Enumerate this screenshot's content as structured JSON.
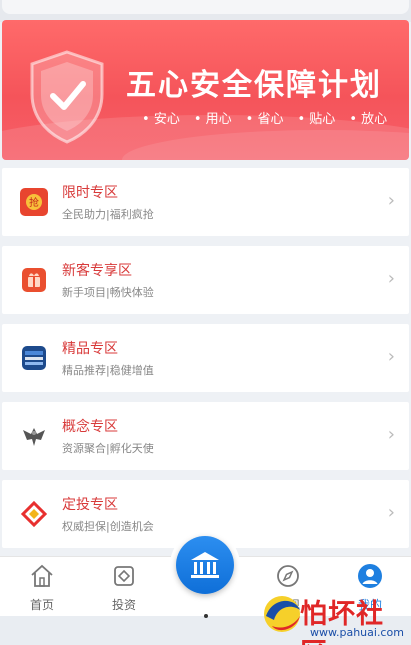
{
  "banner": {
    "title": "五心安全保障计划",
    "tags": [
      "安心",
      "用心",
      "省心",
      "贴心",
      "放心"
    ]
  },
  "sections": [
    {
      "title": "限时专区",
      "subtitle": "全民助力|福利疯抢",
      "icon": "qiang-icon",
      "color": "#e8452f"
    },
    {
      "title": "新客专享区",
      "subtitle": "新手项目|畅快体验",
      "icon": "gift-icon",
      "color": "#e9502f"
    },
    {
      "title": "精品专区",
      "subtitle": "精品推荐|稳健增值",
      "icon": "premium-badge-icon",
      "color": "#1d4a8c"
    },
    {
      "title": "概念专区",
      "subtitle": "资源聚合|孵化天使",
      "icon": "eagle-icon",
      "color": "#666666"
    },
    {
      "title": "定投专区",
      "subtitle": "权威担保|创造机会",
      "icon": "fixed-invest-logo-icon",
      "color": "#e8302f"
    }
  ],
  "tabbar": {
    "home": "首页",
    "invest": "投资",
    "discover": "发现",
    "mine": "我的"
  },
  "watermark": {
    "text": "怕坏社区",
    "url": "www.pahuai.com"
  }
}
